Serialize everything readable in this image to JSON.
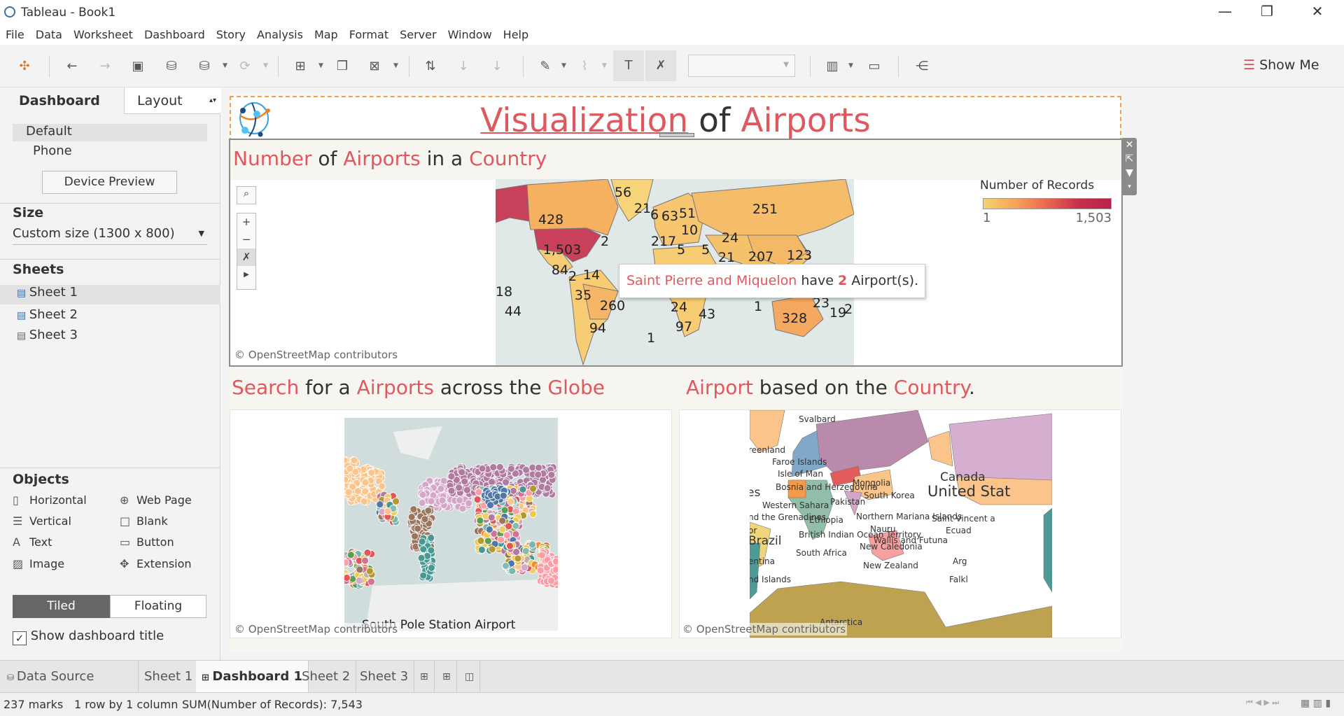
{
  "window": {
    "title": "Tableau - Book1",
    "minimize": "—",
    "restore": "❐",
    "close": "✕"
  },
  "menu": [
    "File",
    "Data",
    "Worksheet",
    "Dashboard",
    "Story",
    "Analysis",
    "Map",
    "Format",
    "Server",
    "Window",
    "Help"
  ],
  "toolbar": {
    "show_me": "Show Me"
  },
  "left_panel": {
    "tabs": {
      "dashboard": "Dashboard",
      "layout": "Layout"
    },
    "devices": [
      "Default",
      "Phone"
    ],
    "device_preview": "Device Preview",
    "size_header": "Size",
    "size_value": "Custom size (1300 x 800)",
    "sheets_header": "Sheets",
    "sheets": [
      "Sheet 1",
      "Sheet 2",
      "Sheet 3"
    ],
    "objects_header": "Objects",
    "objects": [
      "Horizontal",
      "Web Page",
      "Vertical",
      "Blank",
      "Text",
      "Button",
      "Image",
      "Extension"
    ],
    "tiled": "Tiled",
    "floating": "Floating",
    "show_title": "Show dashboard title"
  },
  "dashboard": {
    "title": {
      "w1": "Visualization",
      "w2": " of ",
      "w3": "Airports"
    },
    "map1": {
      "title": {
        "w1": "Number",
        "w2": " of  ",
        "w3": "Airports",
        "w4": " in a ",
        "w5": "Country"
      },
      "labels": [
        "56",
        "21",
        "6",
        "63",
        "51",
        "251",
        "428",
        "10",
        "24",
        "2",
        "217",
        "1,503",
        "5",
        "5",
        "21",
        "207",
        "123",
        "84",
        "2",
        "14",
        "18",
        "35",
        "44",
        "260",
        "24",
        "1",
        "23",
        "19",
        "2",
        "43",
        "328",
        "94",
        "97",
        "1"
      ],
      "legend": {
        "title": "Number of Records",
        "min": "1",
        "max": "1,503"
      },
      "tooltip": {
        "country": "Saint Pierre and Miquelon",
        "have": " have ",
        "count": "2",
        "rest": " Airport(s)."
      },
      "attribution": "© OpenStreetMap contributors"
    },
    "map2": {
      "title": {
        "w1": "Search",
        "w2": " for a ",
        "w3": "Airports",
        "w4": " across the ",
        "w5": "Globe"
      },
      "caption": "South Pole Station Airport",
      "attribution": "© OpenStreetMap contributors"
    },
    "map3": {
      "title": {
        "w1": "Airport",
        "w2": " based on the ",
        "w3": "Country",
        "w4": "."
      },
      "labels": [
        "Svalbard",
        "reenland",
        "Faroe Islands",
        "Isle of Man",
        "Bosnia and Herzegovina",
        "es",
        "Mongolia",
        "South Korea",
        "Western Sahara",
        "Pakistan",
        "nd the Grenadines",
        "Ethiopia",
        "Northern Mariana Islands",
        "Nauru",
        "British Indian Ocean Territory",
        "Wallis and Futuna",
        "New Caledonia",
        "Brazil",
        "South Africa",
        "New Zealand",
        "entina",
        "nd Islands",
        "Canada",
        "United Stat",
        "Saint Vincent a",
        "Ecuad",
        "Arg",
        "Falkl",
        "Antarctica",
        "or"
      ],
      "attribution": "© OpenStreetMap contributors"
    },
    "colors": {
      "accent": "#e0585f",
      "legend_low": "#f4d26e",
      "legend_high": "#b8224a"
    }
  },
  "sheet_tabs": [
    "Data Source",
    "Sheet 1",
    "Dashboard 1",
    "Sheet 2",
    "Sheet 3"
  ],
  "status": {
    "marks": "237 marks",
    "rows": "1 row by 1 column",
    "sum": "SUM(Number of Records): 7,543"
  }
}
